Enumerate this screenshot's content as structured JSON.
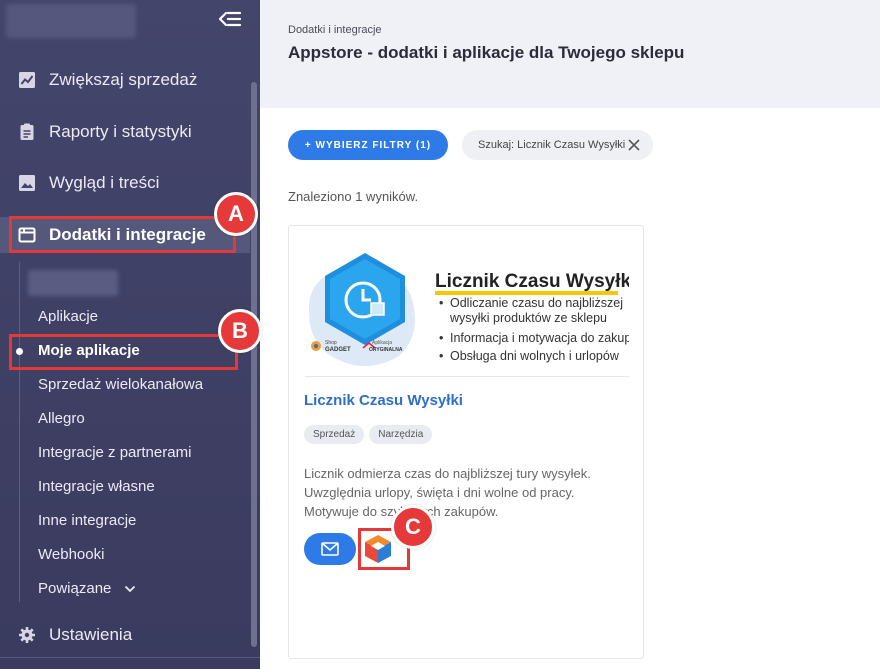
{
  "sidebar": {
    "main_items": [
      {
        "label": "Zwiększaj sprzedaż"
      },
      {
        "label": "Raporty i statystyki"
      },
      {
        "label": "Wygląd i treści"
      },
      {
        "label": "Dodatki i integracje"
      },
      {
        "label": "Ustawienia"
      }
    ],
    "sub_items": [
      {
        "label": "Aplikacje"
      },
      {
        "label": "Moje aplikacje"
      },
      {
        "label": "Sprzedaż wielokanałowa"
      },
      {
        "label": "Allegro"
      },
      {
        "label": "Integracje z partnerami"
      },
      {
        "label": "Integracje własne"
      },
      {
        "label": "Inne integracje"
      },
      {
        "label": "Webhooki"
      },
      {
        "label": "Powiązane"
      }
    ]
  },
  "header": {
    "breadcrumb": "Dodatki i integracje",
    "title": "Appstore - dodatki i aplikacje dla Twojego sklepu"
  },
  "filters": {
    "button_label": "+ WYBIERZ FILTRY (1)",
    "search_chip": "Szukaj: Licznik Czasu Wysyłki"
  },
  "results_text": "Znaleziono 1 wyników.",
  "card": {
    "banner": {
      "title": "Licznik Czasu Wysyłki",
      "bullets": [
        "Odliczanie czasu do najbliższej",
        "wysyłki produktów ze sklepu",
        "Informacja i motywacja do zakupu",
        "Obsługa dni wolnych i urlopów"
      ],
      "logo_top": "Shop",
      "logo_brand": "GADGET",
      "app_badge_top": "Aplikacja",
      "app_badge_bottom": "ORYGINALNA"
    },
    "name": "Licznik Czasu Wysyłki",
    "tags": [
      "Sprzedaż",
      "Narzędzia"
    ],
    "description": "Licznik odmierza czas do najbliższej tury wysyłek. Uwzględnia urlopy, święta i dni wolne od pracy. Motywuje do szybszych zakupów."
  },
  "annotations": {
    "a": "A",
    "b": "B",
    "c": "C"
  },
  "colors": {
    "accent": "#2e7be8",
    "sidebar": "#3f4066",
    "highlight": "#e53838"
  }
}
